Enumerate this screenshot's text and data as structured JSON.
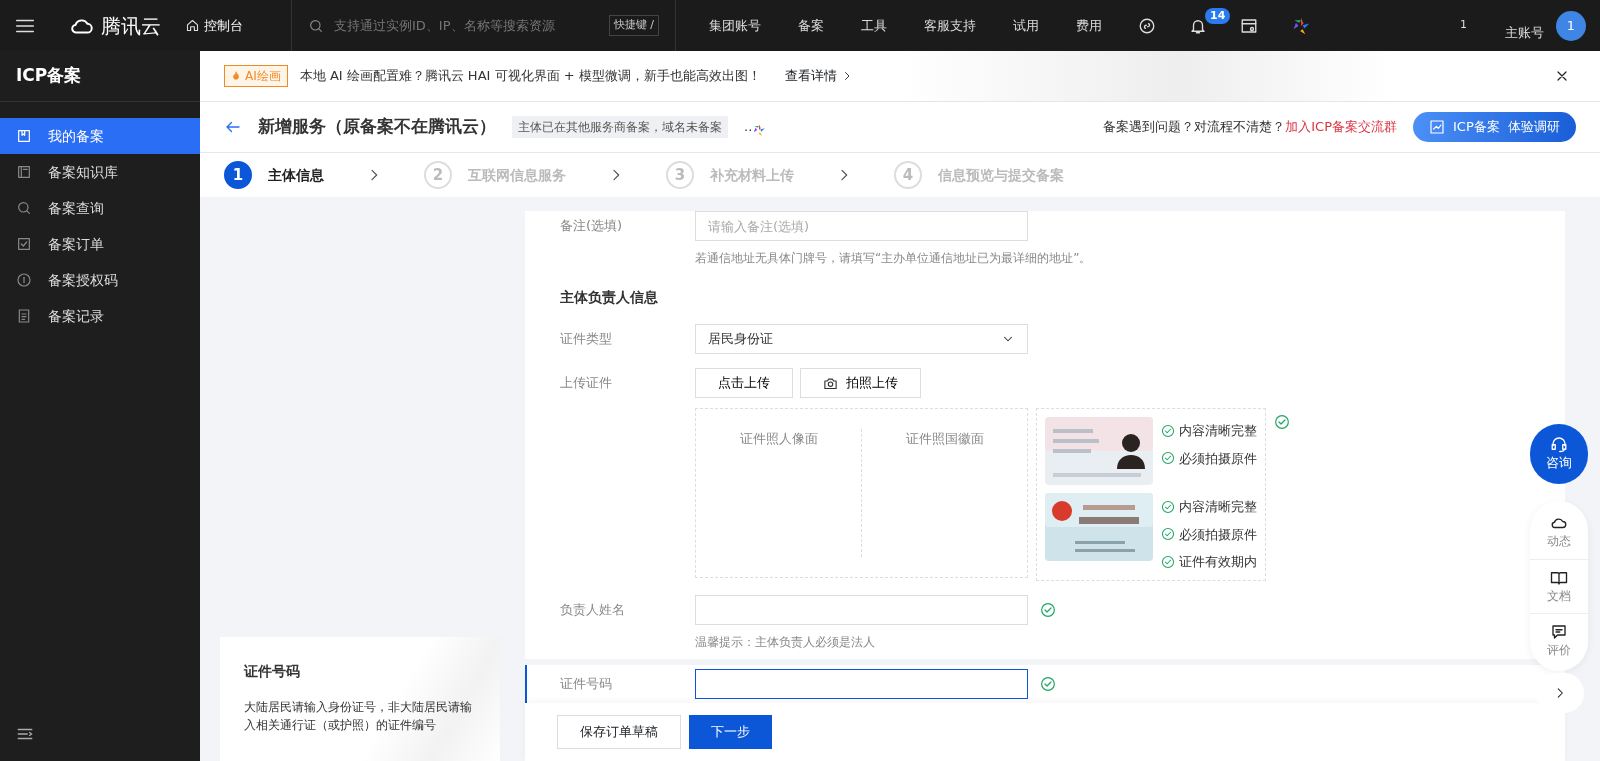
{
  "topbar": {
    "brand": "腾讯云",
    "console": "控制台",
    "search": {
      "placeholder": "支持通过实例ID、IP、名称等搜索资源"
    },
    "shortcut": "快捷键 /",
    "menu": [
      "集团账号",
      "备案",
      "工具",
      "客服支持",
      "试用",
      "费用"
    ],
    "notifications": "14",
    "counter": "1",
    "account": "主账号",
    "avatar": "1"
  },
  "sidebar": {
    "title": "ICP备案",
    "items": [
      {
        "label": "我的备案",
        "selected": true
      },
      {
        "label": "备案知识库",
        "selected": false
      },
      {
        "label": "备案查询",
        "selected": false
      },
      {
        "label": "备案订单",
        "selected": false
      },
      {
        "label": "备案授权码",
        "selected": false
      },
      {
        "label": "备案记录",
        "selected": false
      }
    ]
  },
  "banner": {
    "tag": "AI绘画",
    "text": "本地 AI 绘画配置难？腾讯云 HAI 可视化界面 + 模型微调，新手也能高效出图！",
    "link": "查看详情"
  },
  "header": {
    "title": "新增服务（原备案不在腾讯云）",
    "tag": "主体已在其他服务商备案，域名未备案",
    "dots": "..",
    "question": "备案遇到问题？对流程不清楚？",
    "group_link": "加入ICP备案交流群",
    "survey": "ICP备案  体验调研"
  },
  "steps": [
    {
      "number": "1",
      "label": "主体信息",
      "selected": true
    },
    {
      "number": "2",
      "label": "互联网信息服务",
      "selected": false
    },
    {
      "number": "3",
      "label": "补充材料上传",
      "selected": false
    },
    {
      "number": "4",
      "label": "信息预览与提交备案",
      "selected": false
    }
  ],
  "form": {
    "remark": {
      "label": "备注(选填)",
      "placeholder": "请输入备注(选填)",
      "hint": "若通信地址无具体门牌号，请填写“主办单位通信地址已为最详细的地址”。"
    },
    "section": "主体负责人信息",
    "id_type": {
      "label": "证件类型",
      "value": "居民身份证"
    },
    "upload": {
      "label": "上传证件",
      "buttons": [
        "点击上传",
        "拍照上传"
      ],
      "slots": [
        "证件照人像面",
        "证件照国徽面"
      ],
      "valid": true,
      "samples": [
        {
          "checks": [
            "内容清晰完整",
            "必须拍摄原件"
          ]
        },
        {
          "checks": [
            "内容清晰完整",
            "必须拍摄原件",
            "证件有效期内"
          ]
        }
      ]
    },
    "name": {
      "label": "负责人姓名",
      "hint": "温馨提示：主体负责人必须是法人",
      "valid": true
    },
    "id_number": {
      "label": "证件号码",
      "valid": true
    }
  },
  "help": {
    "title": "证件号码",
    "text": "大陆居民请输入身份证号，非大陆居民请输入相关通行证（或护照）的证件编号"
  },
  "footer": {
    "buttons": [
      "保存订单草稿",
      "下一步"
    ]
  },
  "float_tools": {
    "consult": "咨询",
    "items": [
      {
        "label": "动态"
      },
      {
        "label": "文档"
      },
      {
        "label": "评价"
      }
    ]
  }
}
